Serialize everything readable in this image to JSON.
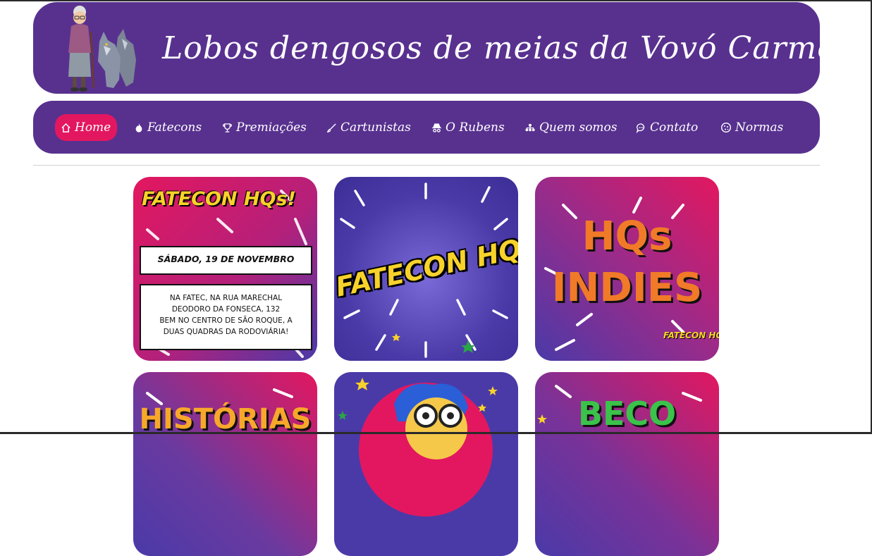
{
  "header": {
    "title": "Lobos dengosos de meias da Vovó Carmela",
    "mascot_icon": "grandma-with-wolves-icon",
    "background": "#58318f"
  },
  "nav": {
    "items": [
      {
        "label": "Home",
        "icon": "home-icon"
      },
      {
        "label": "Fatecons",
        "icon": "flame-icon"
      },
      {
        "label": "Premiações",
        "icon": "trophy-icon"
      },
      {
        "label": "Cartunistas",
        "icon": "brush-icon"
      },
      {
        "label": "O Rubens",
        "icon": "incognito-icon"
      },
      {
        "label": "Quem somos",
        "icon": "people-icon"
      },
      {
        "label": "Contato",
        "icon": "chat-icon"
      },
      {
        "label": "Normas",
        "icon": "cookie-icon"
      }
    ],
    "active_color": "#e3175f"
  },
  "cards": {
    "card1": {
      "logo": "FATECON HQs!",
      "date": "SÁBADO, 19 DE NOVEMBRO",
      "addr1": "NA FATEC, NA RUA MARECHAL",
      "addr2": "DEODORO DA FONSECA, 132",
      "addr3": "BEM NO CENTRO DE SÃO ROQUE, A",
      "addr4": "DUAS QUADRAS DA RODOVIÁRIA!"
    },
    "card2": {
      "logo": "FATECON HQs!"
    },
    "card3": {
      "line1": "HQs",
      "line2": "INDIES",
      "logo": "FATECON HQs!"
    },
    "card4": {
      "title": "HISTÓRIAS"
    },
    "card5": {
      "icon": "cartoon-face-icon"
    },
    "card6": {
      "title": "BECO"
    }
  },
  "colors": {
    "pink": "#e3175f",
    "purple": "#4a3aa8",
    "yellow": "#f7d22a",
    "orange": "#f07a28"
  }
}
